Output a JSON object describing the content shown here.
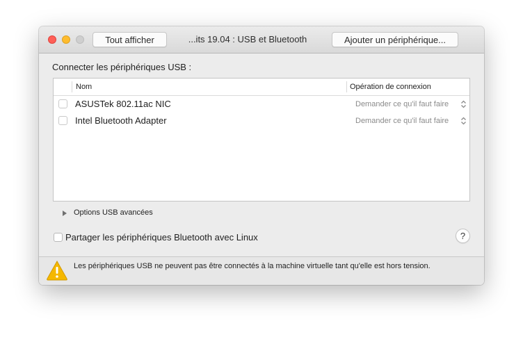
{
  "window": {
    "title": "...its 19.04 : USB et Bluetooth",
    "show_all_label": "Tout afficher",
    "add_device_label": "Ajouter un périphérique..."
  },
  "usb": {
    "section_label": "Connecter les périphériques USB :",
    "columns": {
      "name": "Nom",
      "operation": "Opération de connexion"
    },
    "devices": [
      {
        "name": "ASUSTek 802.11ac NIC",
        "operation": "Demander ce qu'il faut faire",
        "checked": false
      },
      {
        "name": "Intel Bluetooth Adapter",
        "operation": "Demander ce qu'il faut faire",
        "checked": false
      }
    ],
    "advanced_options_label": "Options USB avancées"
  },
  "bluetooth": {
    "share_label": "Partager les périphériques Bluetooth avec Linux",
    "share_checked": false
  },
  "help": {
    "label": "?"
  },
  "footer": {
    "warning_text": "Les périphériques USB ne peuvent pas être connectés à la machine virtuelle tant qu'elle est hors tension.",
    "icon": "warning-icon"
  },
  "colors": {
    "close": "#fe5f57",
    "minimize": "#febc2e",
    "zoom_disabled": "#cfcfcf",
    "warning": "#f5b800"
  }
}
